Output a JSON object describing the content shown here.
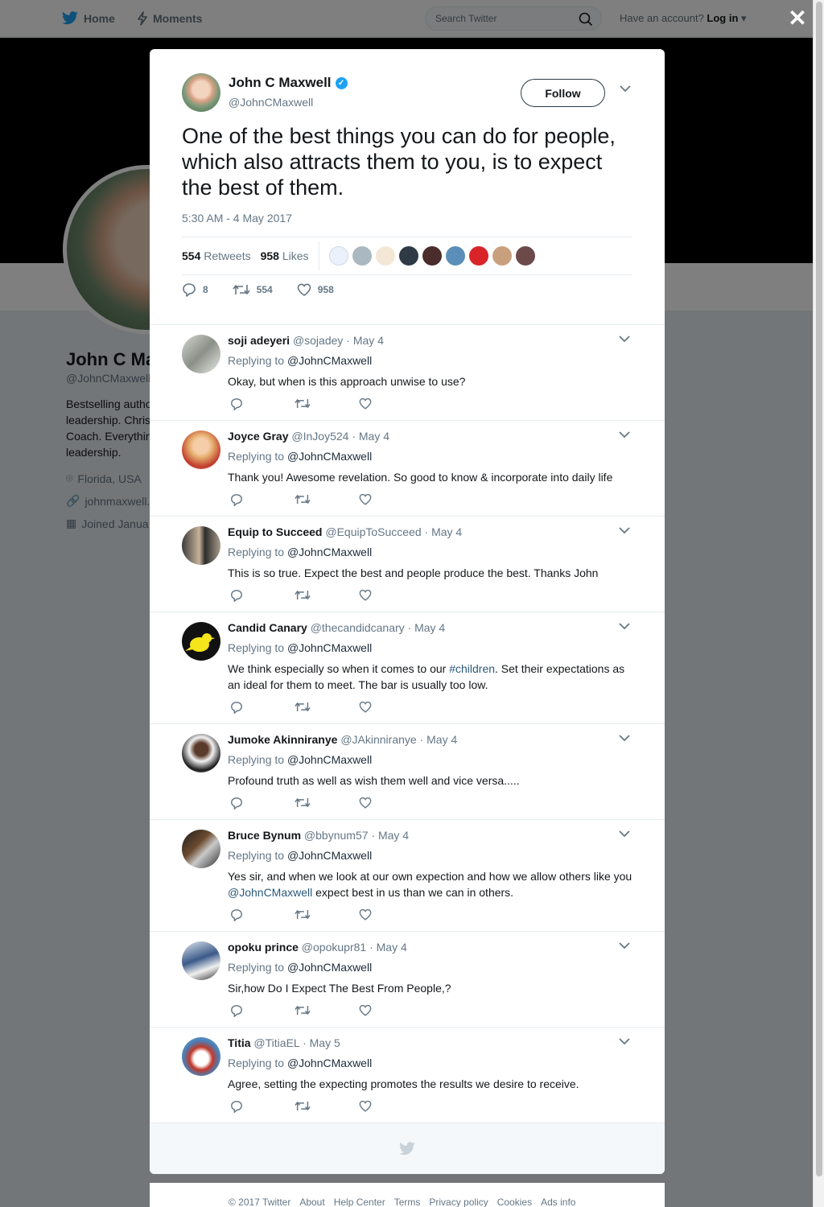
{
  "nav": {
    "home_label": "Home",
    "moments_label": "Moments",
    "search_placeholder": "Search Twitter",
    "account_prompt": "Have an account?",
    "login_label": "Log in"
  },
  "profile": {
    "name": "John C Maxwell",
    "handle": "@JohnCMaxwell",
    "bio_lines": [
      "Bestselling author",
      "leadership. Chris",
      "Coach. Everythin",
      "leadership."
    ],
    "location": "Florida, USA",
    "website": "johnmaxwell.c",
    "joined": "Joined Janua"
  },
  "tweet": {
    "author_name": "John C Maxwell",
    "author_handle": "@JohnCMaxwell",
    "follow_label": "Follow",
    "text": "One of the best things you can do for people, which also attracts them to you, is to expect the best of them.",
    "timestamp": "5:30 AM - 4 May 2017",
    "retweets_count": "554",
    "retweets_label": "Retweets",
    "likes_count": "958",
    "likes_label": "Likes",
    "reply_count": "8",
    "retweet_action_count": "554",
    "like_action_count": "958"
  },
  "replies": [
    {
      "name": "soji adeyeri",
      "handle": "@sojadey",
      "date": "· May 4",
      "replying_label": "Replying to",
      "replying_to": "@JohnCMaxwell",
      "text": "Okay, but when is this approach unwise to use?"
    },
    {
      "name": "Joyce Gray",
      "handle": "@InJoy524",
      "date": "· May 4",
      "replying_label": "Replying to",
      "replying_to": "@JohnCMaxwell",
      "text": "Thank you! Awesome revelation. So good to know & incorporate into daily life"
    },
    {
      "name": "Equip to Succeed",
      "handle": "@EquipToSucceed",
      "date": "· May 4",
      "replying_label": "Replying to",
      "replying_to": "@JohnCMaxwell",
      "text": "This is so true. Expect the best and people produce the best. Thanks John"
    },
    {
      "name": "Candid Canary",
      "handle": "@thecandidcanary",
      "date": "· May 4",
      "replying_label": "Replying to",
      "replying_to": "@JohnCMaxwell",
      "text_before": "We think especially so when it comes to our ",
      "text_link": "#children",
      "text_after": ". Set their expectations as an ideal for them to meet. The bar is usually too low."
    },
    {
      "name": "Jumoke Akinniranye",
      "handle": "@JAkinniranye",
      "date": "· May 4",
      "replying_label": "Replying to",
      "replying_to": "@JohnCMaxwell",
      "text": "Profound truth as well as wish them well and vice versa....."
    },
    {
      "name": "Bruce Bynum",
      "handle": "@bbynum57",
      "date": "· May 4",
      "replying_label": "Replying to",
      "replying_to": "@JohnCMaxwell",
      "text_before": "Yes sir, and when we look at our own expection and how we allow others like you ",
      "text_link": "@JohnCMaxwell",
      "text_after": " expect best in us than we can in others."
    },
    {
      "name": "opoku prince",
      "handle": "@opokupr81",
      "date": "· May 4",
      "replying_label": "Replying to",
      "replying_to": "@JohnCMaxwell",
      "text": "Sir,how Do I Expect The Best From People,?"
    },
    {
      "name": "Titia",
      "handle": "@TitiaEL",
      "date": "· May 5",
      "replying_label": "Replying to",
      "replying_to": "@JohnCMaxwell",
      "text": "Agree, setting the expecting promotes the results we desire to receive."
    }
  ],
  "footer": {
    "copyright": "© 2017 Twitter",
    "links": [
      "About",
      "Help Center",
      "Terms",
      "Privacy policy",
      "Cookies",
      "Ads info"
    ]
  },
  "icons": {
    "twitter_bird": "twitter-bird-icon",
    "moments": "lightning-icon",
    "search": "search-icon",
    "close": "close-icon",
    "reply": "reply-icon",
    "retweet": "retweet-icon",
    "like": "heart-icon",
    "caret": "chevron-down-icon"
  },
  "colors": {
    "brand": "#1da1f2",
    "text": "#14171a",
    "muted": "#657786",
    "overlay": "rgba(0,0,0,0.5)"
  }
}
